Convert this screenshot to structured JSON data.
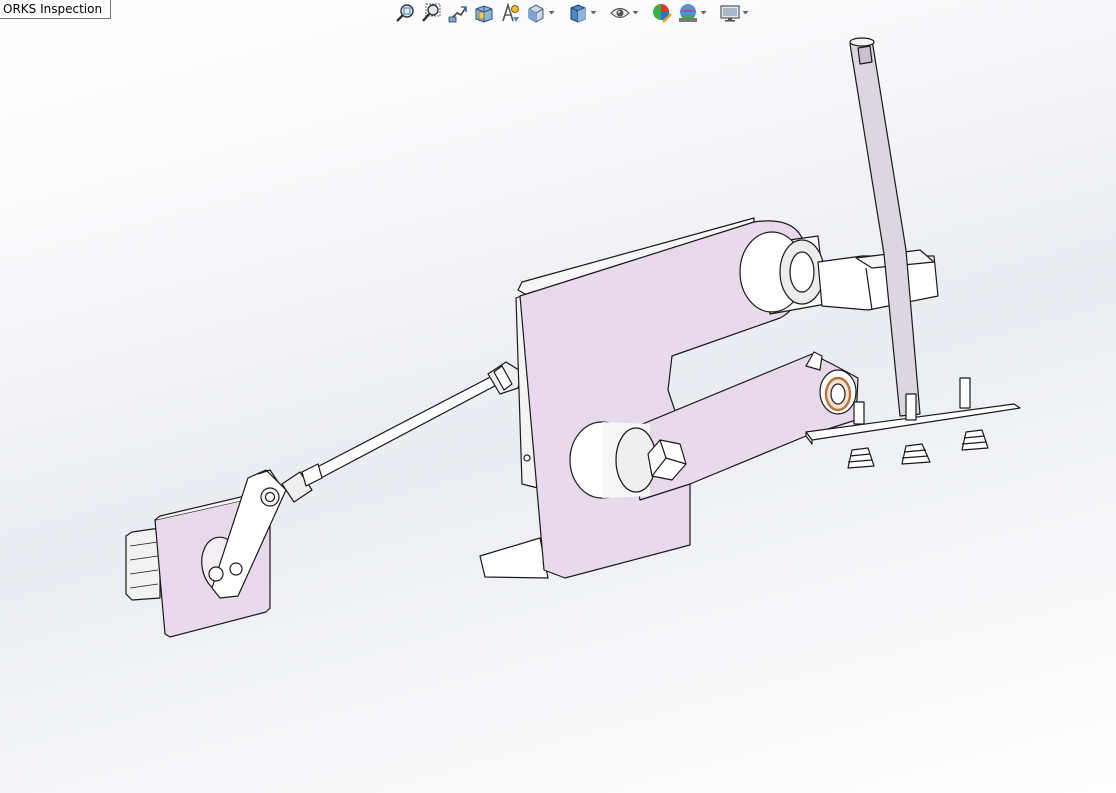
{
  "tooltip": {
    "text": "ORKS Inspection"
  },
  "toolbar": {
    "buttons": [
      {
        "icon": "zoom-to-fit-icon",
        "has_menu": false
      },
      {
        "icon": "zoom-to-area-icon",
        "has_menu": false
      },
      {
        "icon": "previous-view-icon",
        "has_menu": false
      },
      {
        "icon": "section-view-icon",
        "has_menu": false
      },
      {
        "icon": "dynamic-annotation-views-icon",
        "has_menu": false
      },
      {
        "icon": "view-orientation-icon",
        "has_menu": true
      },
      {
        "icon": "display-style-icon",
        "has_menu": true
      },
      {
        "icon": "hide-show-items-icon",
        "has_menu": true
      },
      {
        "icon": "edit-appearance-icon",
        "has_menu": false
      },
      {
        "icon": "apply-scene-icon",
        "has_menu": true
      },
      {
        "icon": "view-settings-icon",
        "has_menu": true
      }
    ]
  },
  "model": {
    "part_color": "#e8d9ec",
    "edge_color": "#1a1a1a",
    "shaft_color": "#dcd6e0",
    "bearing_accent": "#c0703a"
  }
}
